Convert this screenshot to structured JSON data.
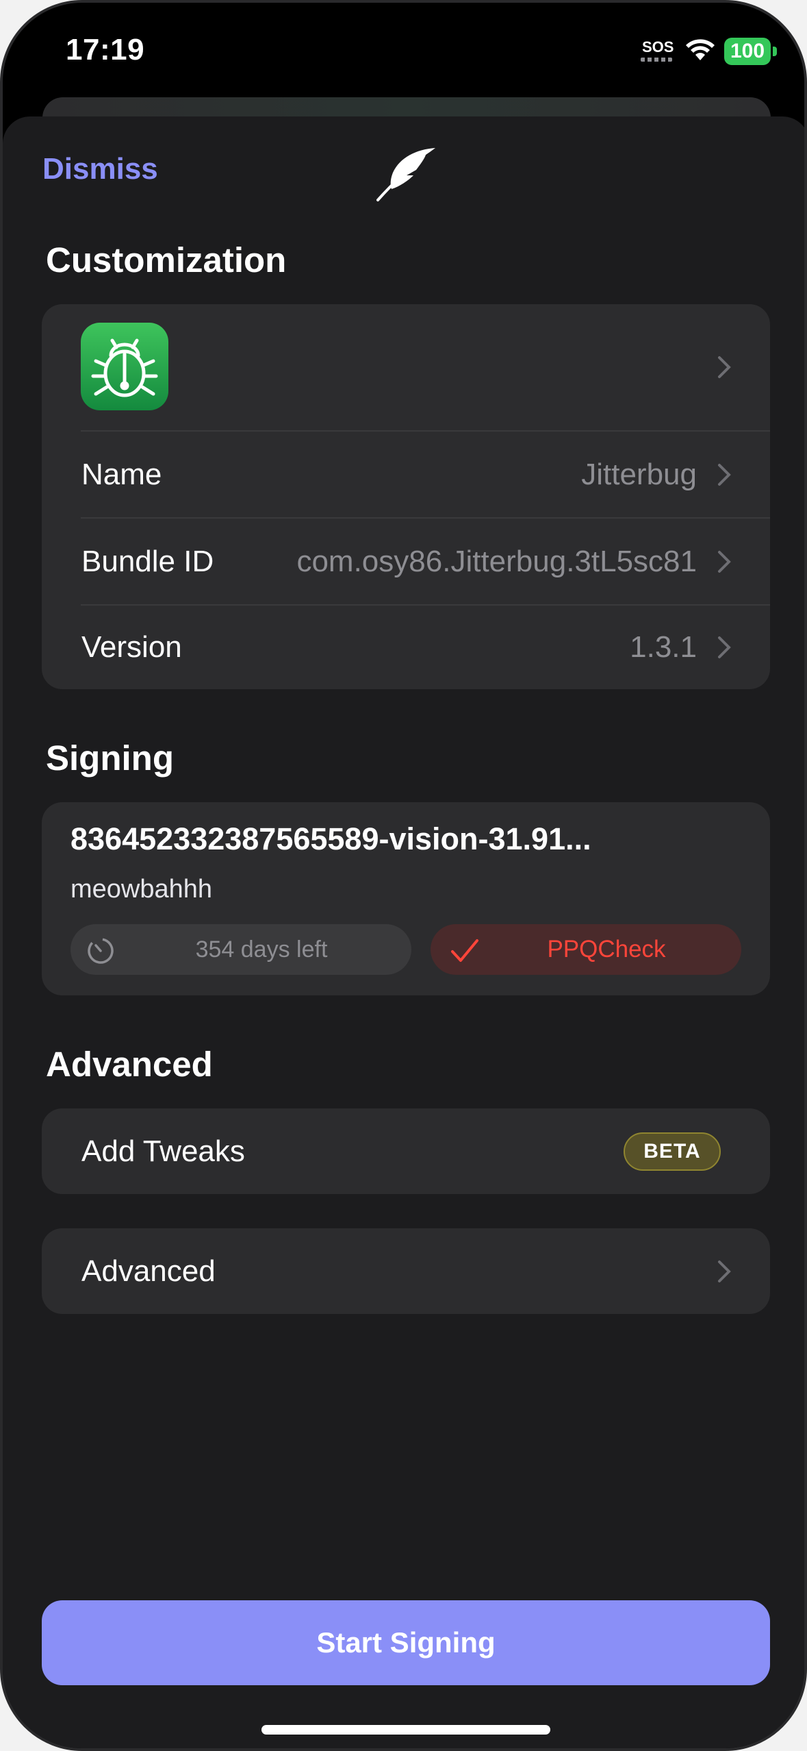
{
  "status_bar": {
    "time": "17:19",
    "sos": "SOS",
    "battery": "100"
  },
  "header": {
    "dismiss_label": "Dismiss",
    "logo_icon": "feather-icon"
  },
  "customization": {
    "title": "Customization",
    "app_icon": "bug-icon",
    "rows": [
      {
        "label": "Name",
        "value": "Jitterbug"
      },
      {
        "label": "Bundle ID",
        "value": "com.osy86.Jitterbug.3tL5sc81"
      },
      {
        "label": "Version",
        "value": "1.3.1"
      }
    ]
  },
  "signing": {
    "title": "Signing",
    "certificate_name": "83645233238756​5589-vision-31.91...",
    "certificate_subtitle": "meowbahhh",
    "days_left": "354 days left",
    "check_label": "PPQCheck"
  },
  "advanced": {
    "title": "Advanced",
    "tweaks_label": "Add Tweaks",
    "beta_badge": "BETA",
    "advanced_label": "Advanced"
  },
  "footer": {
    "start_label": "Start Signing"
  },
  "colors": {
    "accent": "#8a8ff7",
    "background": "#1c1c1e",
    "card": "#2c2c2e",
    "danger": "#ff453a",
    "secondary_text": "#8e8e93"
  }
}
